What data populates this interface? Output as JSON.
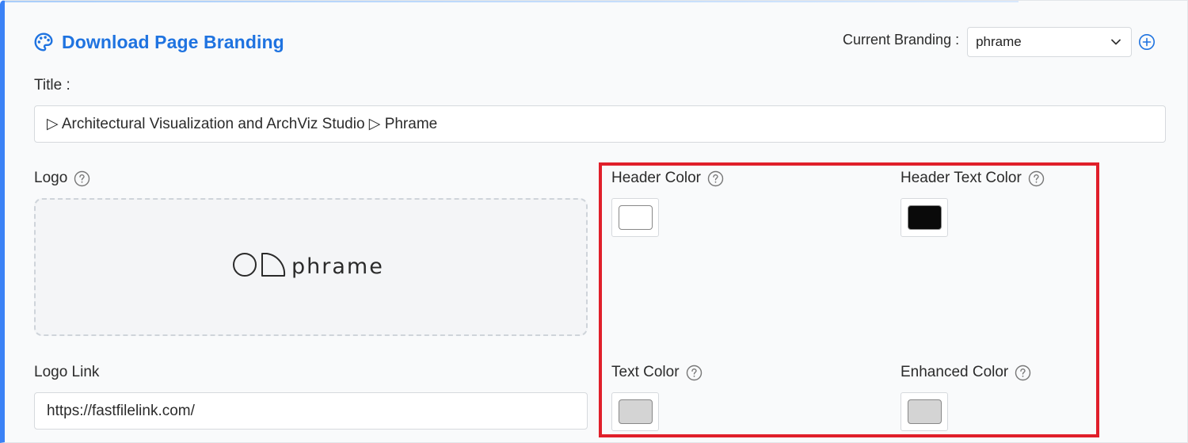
{
  "header": {
    "title": "Download Page Branding",
    "icon": "palette-icon",
    "accent_color": "#1f73e0"
  },
  "branding": {
    "label": "Current Branding :",
    "selected": "phrame"
  },
  "title_field": {
    "label": "Title :",
    "value": "▷ Architectural Visualization and ArchViz Studio ▷ Phrame"
  },
  "logo": {
    "label": "Logo",
    "image_text": "phrame"
  },
  "logo_link": {
    "label": "Logo Link",
    "value": "https://fastfilelink.com/"
  },
  "colors": {
    "header_color": {
      "label": "Header Color",
      "value": "#ffffff"
    },
    "header_text_color": {
      "label": "Header Text Color",
      "value": "#0a0a0a"
    },
    "text_color": {
      "label": "Text Color",
      "value": "#d4d4d4"
    },
    "enhanced_color": {
      "label": "Enhanced Color",
      "value": "#d4d4d4"
    }
  },
  "highlight_color": "#e01f2a"
}
